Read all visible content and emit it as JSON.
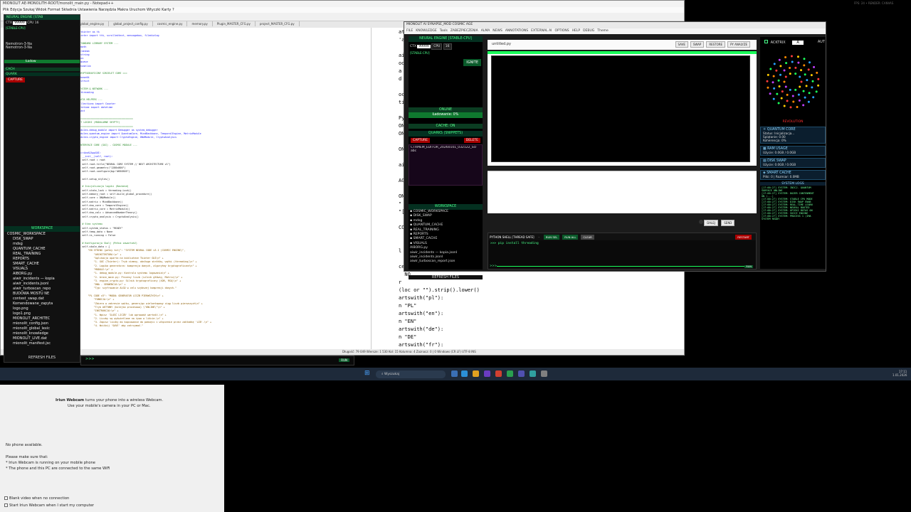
{
  "npp": {
    "title": "MIONOLIT AE-MONOLITH-ROOT/monolit_main.py - Notepad++",
    "menu": "Plik  Edycja  Szukaj  Widok  Format  Składnia  Ustawienia  Narzędzia  Makra  Uruchom  Wtyczki  Karty  ?",
    "tabs": [
      "main.py",
      "global_engine.py",
      "global_project_config.py",
      "cosmic_engine.py",
      "memory.py",
      "Plugin_MASTER_CFG.py",
      "project_MASTER_CFG.py"
    ],
    "status": "Python file",
    "status_right": "Długość: 79 049    Wiersze: 1 530       Kol: 15    Kolumna: 4    Zaznacz: 0 | 0                 Windows (CR LF)    UTF-8                 INS",
    "code_left": [
      "import tkinter as tk",
      "from tkinter import ttk, scrolledtext, messagebox, filedialog",
      "",
      "# --- STANDARD LIBRARY SYSTEM ---",
      "import math",
      "import random",
      "import string",
      "import os",
      "import queue",
      "import hashlib",
      "",
      "# === KRYPTOGRAFICZNY SZKIELET CORE ===",
      "import base64",
      "import struct",
      "",
      "# --- SYSTEM & NETWORK ---",
      "import threading",
      "",
      "# --- DATA HELPERS ---",
      "from collections import Counter",
      "from datetime import datetime",
      "import ast",
      "",
      "# =========================================",
      "# IMPORT LOGIKI (MODULARNE SKYPTY)",
      "# =========================================",
      "from modules.debug_module import Debugger as system_debugger",
      "from modules.quantum_engine import QuantumCore, MindBackbone, TemporalEngine, MatrixModule",
      "from modules.crypto_engine import CryptoEngine, DNAModule, CryptoAnalysis",
      "",
      "# --- INTERFACE CORE (GUI) - COSMIC MODULE ---",
      "",
      "class ScribeAIAppGUI:",
      "    def __init__(self, root):",
      "        self.root = root",
      "        self.root.title(\"NEURAL CORE SYSTEM // NEXT ARCHITECTURE v1\")",
      "        self.root.geometry(\"1280x800\")",
      "        self.root.configure(bg=\"#050505\")",
      "",
      "        self.setup_styles()",
      "",
      "        # Inicjalizacja logiki (Backend)",
      "        self.state_lock = threading.Lock()",
      "        self.memory_root = self.build_global_procedure()",
      "        self.core = DNAModule()",
      "        self.matrix = MindBackbone()",
      "        self.dna_core = TemporalEngine()",
      "        self.matrix_core = MatrixModule()",
      "        self.dna_calc = AdvancedNumberTheory()",
      "        self.crypto_analysis = CryptoAnalysis()",
      "",
      "        # Stan systemu",
      "        self.system_status = \"READY\"",
      "        self.temp_data = None",
      "        self.is_running = False",
      "",
      "        # Konfiguracja Skalj (Pełna zawartość)",
      "        self.skale_data = {",
      "            \"EN STRING (pełny txt)\": \"SYSTEM NEURAL CODE v3.1 (COSMIC ENGINE)\",",
      "                \"ARCHITEKTURA:\\n\" +",
      "                \"Aplikacja oparta na bibliotece Tkinter GUI\\n\" +",
      "                \"1. GUI (Tkinter): Tryb ciemny, obsługa skrótów, wątki (threading)\\n\" +",
      "                \"2. Logika generatora: kompresja danych, algorytmy kryptograficzne\\n\" +",
      "                \"MODULE:\\n\" +",
      "                \"1. debug_module.py: Kontrola systemu logowania\\n\" +",
      "                \"2. brain_main.py: Procesy liczb (silnik główny, Matrix)\\n\" +",
      "                \"3. engine_crypto.py: Silnik kryptograficzny (XOR, RSA)\\n\" +",
      "                \"DNA - SEKWENCJA:\\n\" +",
      "                \"Typ: szyfrowanie ALGO w celu szybszej kompresji danych.\"",
      "",
      "            \"PL CODE v3\": \"MODUŁ GENERATOR LICZB PIERWSZYCH\\n\" +",
      "                \"FUNKCJA:\\n\" +",
      "                \"Zbiera w zakresie wątku, generując wieloetapowy ciąg liczb pierwszych\\n\" +",
      "                \"Tryb AKTYWNY (kolejka procesowa) \\\"ONLINE\\\"\\n\" +",
      "                \"INSTRUKCJA:\\n\" +",
      "                \"1. Wpisz 'ILOŚĆ LICZB' lub wprowadź wartość.\\n\" +",
      "                \"2. Liczby są wyświetlane na żywo w liście.\\n\" +",
      "                \"3. Zapisz liczby do kopiowanie do pamięci i włączenie przez zakładkę 'LIB'.\\n\" +",
      "                \"4. Wciśnij 'SAVE' aby zatrzymać.\""
    ],
    "code_right": [
      "at E",
      "'ass",
      "",
      "aitc",
      "ool(",
      "a = r",
      "d i",
      "",
      "ocol",
      "tion",
      "",
      "PyObj",
      "ON_C",
      "ON_L",
      "",
      "ON",
      "",
      "ai",
      "",
      "AGE(",
      "",
      "ONLY",
      "\"",
      "\"[A",
      "",
      "CORE",
      "",
      "",
      "l",
      "",
      "cep",
      "  NO",
      "r  ",
      "(loc or \"\").strip().lower()",
      "artswith(\"pl\"):",
      "n \"PL\"",
      "artswith(\"en\"):",
      "n \"EN\"",
      "artswith(\"de\"):",
      "n \"DE\"",
      "artswith(\"fr\"):",
      "n \"FR\""
    ]
  },
  "leftapp": {
    "title": "NEURAL ENGINE [STAB",
    "ctx_label": "CTX",
    "ctx_value": "99999",
    "cpu": "CPU",
    "v16": "16",
    "stable": "[STABLE-CPU]",
    "logs": [
      "Nemotron-3-Na",
      "Nemotron-3-Na"
    ],
    "capture": "CAPTURE",
    "quarks": "QUARK",
    "loading": "Ładow",
    "cache": "CACH",
    "workspace": "WORKSPACE",
    "tree_root": "COSMIC_WORKSPACE",
    "tree": [
      "DISK_SWAP",
      "mdsg",
      "QUANTUM_CACHE",
      "REAL_TRAINING",
      "REPORTS",
      "SMART_CACHE",
      "VISUALS",
      "AIBORG.py",
      "aiwir_incidents — kopia",
      "aiwir_incidents.jsonl",
      "aiwir_turboscan_repo",
      "BUDOWA MOSTU NE",
      "contest_swap.dat",
      "Komendowane_zapyta",
      "logo.png",
      "logo1.png",
      "MIONOLIT_ARCHITEC",
      "mionolit_config.json",
      "mionolit_global_lexic",
      "mionolit_knowledge",
      "MIONOLIT_LIVE.dat",
      "mionolit_manifest.jsc"
    ],
    "refresh": "REFRESH FILES"
  },
  "cosmic": {
    "title": "MIONOLIT AI SYNAPSE_MOD COSMIC AGE",
    "menu": [
      "FILE",
      "KNOWLEDGE",
      "Tools",
      "ZABEZPIECZENIA",
      "ALMA",
      "NEWS",
      "ANNOTATIONS",
      "EXTERNAL AI",
      "OPTIONS",
      "HELP",
      "DEBUG",
      "Theme"
    ],
    "neural_head": "NEURAL ENGINE [STABLE-CPU]",
    "ctx": "CTX",
    "ctx_value": "99999",
    "cpu": "CPU",
    "v16": "16",
    "stable": "[STABLE-CPU]",
    "ignite": "IGNITE",
    "online": "ONLINE",
    "loading": "Ładowanie: 0%",
    "cache": "CACHE: ON",
    "quarks": "QUARKS (SNIPPETS)",
    "capture": "CAPTURE",
    "delete": "DELETE",
    "snippet": "CTXMEM_EDITOR_20260101_032122_SO",
    "snippet2": "abc",
    "workspace": "WORKSPACE",
    "tree_root": "COSMIC_WORKSPACE",
    "tree": [
      "DISK_SWAP",
      "mdsg",
      "QUANTUM_CACHE",
      "REAL_TRAINING",
      "REPORTS",
      "SMART_CACHE",
      "VISUALS",
      "AIBORG.py",
      "aiwir_incidents — kopia.jsonl",
      "aiwir_incidents.jsonl",
      "aiwir_turboscan_report.json"
    ],
    "refresh": "REFRESH FILES",
    "filename": "untitled.py",
    "toolbar": [
      "SAVE",
      "SWAP",
      "RESTORE",
      "PY ANALYZE"
    ],
    "nav_prev": "DALEJ",
    "nav_next": "SEND",
    "shell_label": "PYTHON SHELL [THREAD SAFE]",
    "shell_btns": [
      "RUN SEL",
      "RUN ALL",
      "CLEAR"
    ],
    "restart": "RESTART",
    "shell_cmd": ">>> pip install threading",
    "prompt": ">>>"
  },
  "rightpanel": {
    "acktrix": "ACKTRIX",
    "a": "A",
    "aut": "AUT",
    "rev": "REVOLUTION",
    "quantum_title": "QUANTUM CORE",
    "quantum_lines": [
      "Status: Inicjalizacja...",
      "Splątanie: 0.00",
      "Koherencja: 0%"
    ],
    "ram_title": "RAM USAGE",
    "ram_line": "Użycie: 0.0GB / 0.0GB",
    "disk_title": "DISK SWAP",
    "disk_line": "Użycie: 0.0GB / 0.0GB",
    "cache_title": "SMART CACHE",
    "cache_line": "Pliki: 0 | Rozmiar: 0.0MB",
    "logs_title": "SYSTEM LOGS",
    "logs": [
      "[17:00:27] SYSTEM: INICJ. QUANTUM",
      "SURFACE ONLINE",
      "[17:00:27] SYSTEM: DOZER CONTENMENT",
      "ON (...)",
      "[17:00:27] SYSTEM: STABLE CPU MODE",
      "[17:00:27] SYSTEM: DISK SWAP ENAB",
      "[17:00:27] SYSTEM: REAL-TIME LEARN",
      "[17:00:27] SYSTEM: NEURAL BOOTED",
      "[17:00:27] SYSTEM: OPIEKI BOTAS ON",
      "[17:00:27] SYSTEM: VOICE ENGINE",
      "[17:00:27] SYSTEM: PROCESS 1 (IMA",
      "SYSTEM READY"
    ]
  },
  "top_right": "FPS: 24  •  RENDER: CANVAS",
  "taskbar": {
    "search": "Wyszukaj",
    "time": "17:11",
    "date": "1.01.2026"
  },
  "iriun": {
    "headline_bold": "Iriun Webcam",
    "headline_rest": " turns your phone into a wireless Webcam.",
    "sub": "Use your mobile's camera in your PC or Mac.",
    "no_phone": "No phone available.",
    "make_sure": "Please make sure that:",
    "req1": "* Iriun Webcam is running on your mobile phone",
    "req2": "* The phone and this PC are connected to the same WiFi",
    "opt1": "Blank video when no connection",
    "opt2": "Start Iriun Webcam when I start my computer"
  },
  "colors": {
    "accent_green": "#1aff5a",
    "danger": "#aa0000",
    "panel_blue": "#0b1e2e"
  }
}
